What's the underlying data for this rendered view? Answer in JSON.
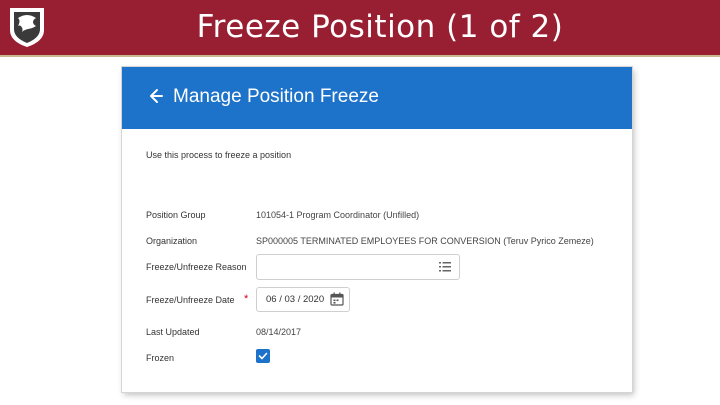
{
  "slide": {
    "title": "Freeze Position (1 of 2)"
  },
  "colors": {
    "banner": "#981e32",
    "header_blue": "#1d72c9"
  },
  "panel": {
    "title": "Manage Position Freeze",
    "back_icon": "arrow-left-icon",
    "instruction": "Use this process to freeze a position"
  },
  "fields": {
    "position_group": {
      "label": "Position Group",
      "value": "101054-1 Program Coordinator (Unfilled)"
    },
    "organization": {
      "label": "Organization",
      "value": "SP000005 TERMINATED EMPLOYEES FOR CONVERSION (Teruv Pyrico Zemeze)"
    },
    "freeze_reason": {
      "label": "Freeze/Unfreeze Reason",
      "value": "",
      "icon": "list-prompt-icon"
    },
    "freeze_date": {
      "label": "Freeze/Unfreeze Date",
      "required_marker": "*",
      "value": "06 / 03 / 2020",
      "icon": "calendar-icon"
    },
    "last_updated": {
      "label": "Last Updated",
      "value": "08/14/2017"
    },
    "frozen": {
      "label": "Frozen",
      "checked": true
    }
  }
}
